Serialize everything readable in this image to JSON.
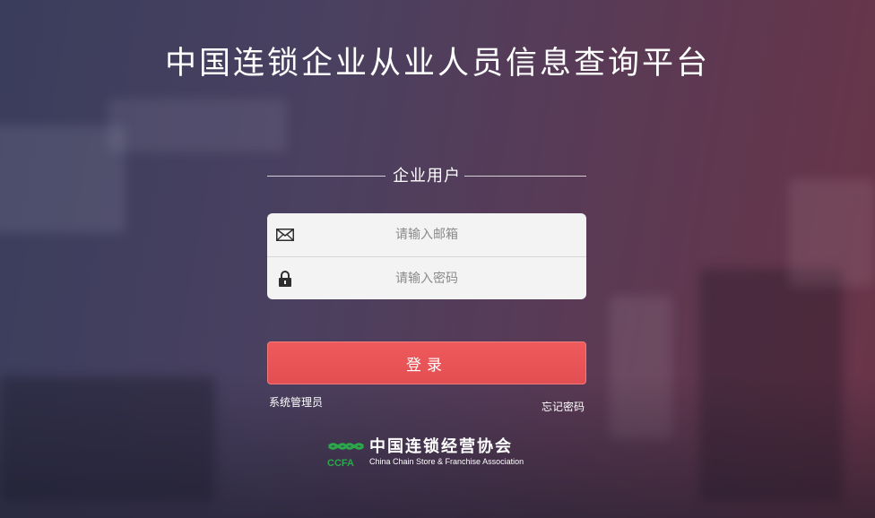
{
  "page": {
    "title": "中国连锁企业从业人员信息查询平台"
  },
  "login": {
    "section_title": "企业用户",
    "email": {
      "placeholder": "请输入邮箱",
      "value": ""
    },
    "password": {
      "placeholder": "请输入密码",
      "value": ""
    },
    "submit_label": "登录",
    "admin_link": "系统管理员",
    "forgot_link": "忘记密码"
  },
  "footer": {
    "logo_cn": "中国连锁经营协会",
    "logo_abbr": "CCFA",
    "logo_en": "China Chain Store & Franchise Association"
  },
  "icons": {
    "email": "envelope-icon",
    "password": "lock-icon",
    "logo": "ccfa-logo"
  },
  "colors": {
    "primary_button": "#e85456",
    "logo_green": "#2aa84a",
    "form_bg": "#f3f3f3"
  }
}
